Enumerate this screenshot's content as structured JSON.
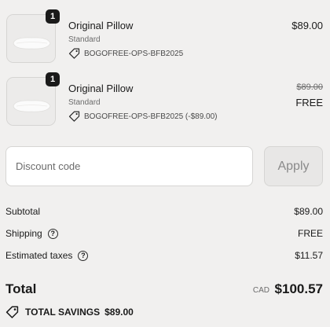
{
  "line_items": [
    {
      "quantity": "1",
      "title": "Original Pillow",
      "variant": "Standard",
      "discount_text": "BOGOFREE-OPS-BFB2025",
      "price": "$89.00"
    },
    {
      "quantity": "1",
      "title": "Original Pillow",
      "variant": "Standard",
      "discount_text": "BOGOFREE-OPS-BFB2025 (-$89.00)",
      "original_price": "$89.00",
      "price": "FREE"
    }
  ],
  "discount": {
    "placeholder": "Discount code",
    "apply_label": "Apply"
  },
  "summary": {
    "subtotal_label": "Subtotal",
    "subtotal_value": "$89.00",
    "shipping_label": "Shipping",
    "shipping_value": "FREE",
    "taxes_label": "Estimated taxes",
    "taxes_value": "$11.57",
    "help_glyph": "?"
  },
  "total": {
    "label": "Total",
    "currency": "CAD",
    "value": "$100.57"
  },
  "savings": {
    "label": "TOTAL SAVINGS",
    "value": "$89.00"
  },
  "icons": {
    "tag": "tag-icon",
    "help": "question-circle-icon",
    "product": "pillow-image"
  }
}
